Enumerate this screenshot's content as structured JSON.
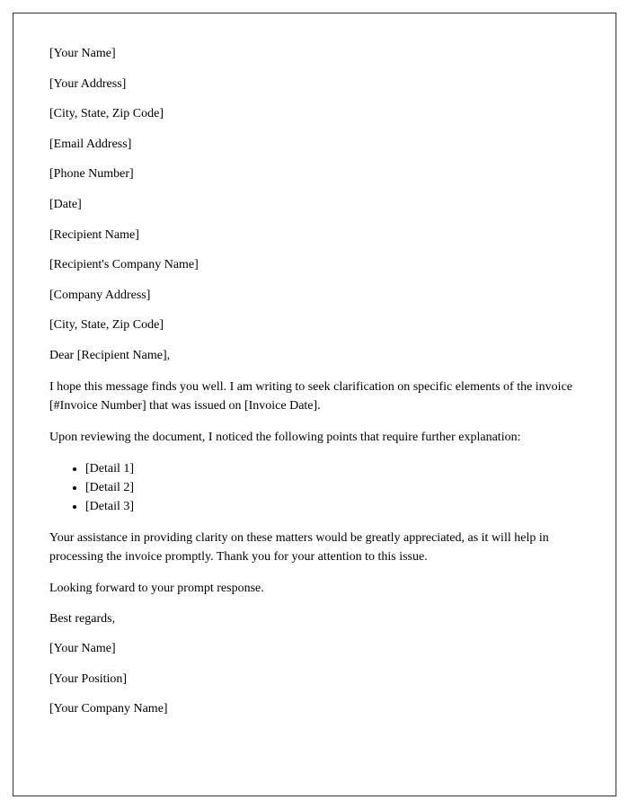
{
  "sender": {
    "name": "[Your Name]",
    "address": "[Your Address]",
    "cityStateZip": "[City, State, Zip Code]",
    "email": "[Email Address]",
    "phone": "[Phone Number]"
  },
  "date": "[Date]",
  "recipient": {
    "name": "[Recipient Name]",
    "company": "[Recipient's Company Name]",
    "address": "[Company Address]",
    "cityStateZip": "[City, State, Zip Code]"
  },
  "salutation": "Dear [Recipient Name],",
  "body": {
    "para1": "I hope this message finds you well. I am writing to seek clarification on specific elements of the invoice [#Invoice Number] that was issued on [Invoice Date].",
    "para2": "Upon reviewing the document, I noticed the following points that require further explanation:",
    "details": [
      "[Detail 1]",
      "[Detail 2]",
      "[Detail 3]"
    ],
    "para3": "Your assistance in providing clarity on these matters would be greatly appreciated, as it will help in processing the invoice promptly. Thank you for your attention to this issue.",
    "para4": "Looking forward to your prompt response."
  },
  "closing": {
    "signoff": "Best regards,",
    "name": "[Your Name]",
    "position": "[Your Position]",
    "company": "[Your Company Name]"
  }
}
